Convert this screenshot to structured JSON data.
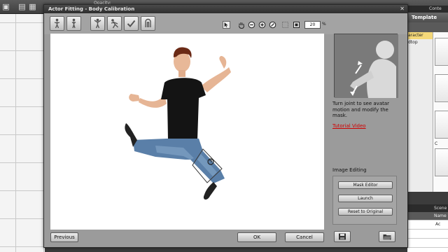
{
  "app": {
    "opacity_label": "Opacity:",
    "toolbar_icons": [
      "align-icon",
      "layers-icon",
      "grid-icon",
      "window-icon"
    ]
  },
  "right_panel": {
    "header_title": "Conte",
    "tab_label": "Template",
    "tree_items": [
      "aracter",
      "dtop"
    ],
    "thumb_labels": [
      "",
      "C"
    ],
    "scene_header": "Scene",
    "scene_column": "Name",
    "scene_row_label": "Ac"
  },
  "dialog": {
    "title": "Actor Fitting - Body Calibration",
    "close_icon": "close-icon",
    "pose_tools": [
      {
        "name": "front-pose-icon"
      },
      {
        "name": "side-pose-icon"
      },
      {
        "name": "arms-pose-icon"
      },
      {
        "name": "bend-pose-icon"
      },
      {
        "name": "confirm-check-icon"
      },
      {
        "name": "mask-pose-icon"
      }
    ],
    "view_tools": [
      "select-arrow-icon",
      "pan-hand-icon",
      "zoom-out-icon",
      "zoom-in-icon",
      "zoom-reset-icon",
      "fit-icon",
      "actual-size-icon"
    ],
    "zoom_value": "20",
    "zoom_unit": "%",
    "hint_text": "Turn joint to see avatar motion and modify the mask.",
    "tutorial_link": "Tutorial Video",
    "image_editing_label": "Image Editing",
    "buttons": {
      "mask_editor": "Mask Editor",
      "launch": "Launch",
      "reset": "Reset to Original",
      "previous": "Previous",
      "ok": "OK",
      "cancel": "Cancel"
    },
    "icon_buttons": [
      "save-icon",
      "open-folder-icon"
    ]
  },
  "colors": {
    "dialog_bg": "#9b9b9b",
    "titlebar": "#3a3a3a",
    "link": "#d00000",
    "preview_bg": "#ffffff"
  }
}
